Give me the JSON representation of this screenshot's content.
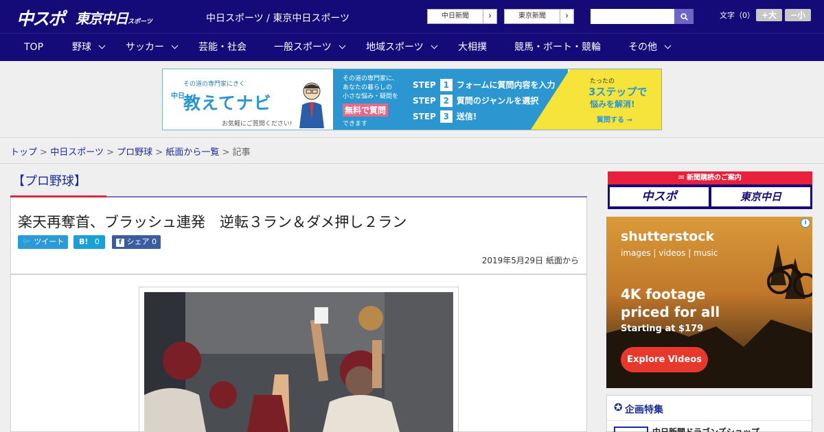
{
  "header": {
    "logo": "中スポ",
    "logo2": "東京中日",
    "logo2_small": "スポーツ",
    "site_title": "中日スポーツ / 東京中日スポーツ",
    "links": [
      {
        "label": "中日新聞"
      },
      {
        "label": "東京新聞"
      }
    ],
    "font_size_label": "文字（0）",
    "font_plus": "+大",
    "font_minus": "−小",
    "search_placeholder": ""
  },
  "nav": {
    "items": [
      {
        "label": "TOP"
      },
      {
        "label": "野球"
      },
      {
        "label": "サッカー"
      },
      {
        "label": "芸能・社会"
      },
      {
        "label": "一般スポーツ"
      },
      {
        "label": "地域スポーツ"
      },
      {
        "label": "大相撲"
      },
      {
        "label": "競馬・ボート・競輪"
      },
      {
        "label": "その他"
      }
    ]
  },
  "banner": {
    "tagline": "その道の専門家にきく",
    "chunichi": "中日",
    "title": "教えてナビ",
    "note": "お気軽にご質問ください!",
    "mid_lines": [
      "その道の専門家に、",
      "あなたの暮らしの",
      "小さな悩み・疑問を"
    ],
    "free": "無料で質問",
    "can": "できます",
    "steps": [
      {
        "step": "STEP",
        "num": "1",
        "text": "フォームに質問内容を入力"
      },
      {
        "step": "STEP",
        "num": "2",
        "text": "質問のジャンルを選択"
      },
      {
        "step": "STEP",
        "num": "3",
        "text": "送信!"
      }
    ],
    "right1": "たったの",
    "right2": "3ステップで",
    "right3": "悩みを解消!",
    "right4": "質問する →"
  },
  "breadcrumb": {
    "items": [
      "トップ",
      "中日スポーツ",
      "プロ野球",
      "紙面から一覧"
    ],
    "sep": ">",
    "current": "記事"
  },
  "article": {
    "category": "【プロ野球】",
    "headline": "楽天再奪首、ブラッシュ連発　逆転３ラン＆ダメ押し２ラン",
    "tweet": "ツイート",
    "hatena": "B!",
    "hatena_count": "0",
    "share": "シェア",
    "share_count": "0",
    "date": "2019年5月29日 紙面から"
  },
  "sidebar": {
    "subscribe_head": "新聞購読のご案内",
    "sub_logo1": "中スポ",
    "sub_logo2": "東京中日",
    "ad_brand": "shutterstock",
    "ad_sub": "images  |  videos  |  music",
    "ad_head1": "4K footage",
    "ad_head2": "priced for all",
    "ad_price": "Starting at $179",
    "ad_btn": "Explore Videos",
    "feature_title": "企画特集",
    "feature_item": "中日新聞ドラゴンズショップ"
  }
}
